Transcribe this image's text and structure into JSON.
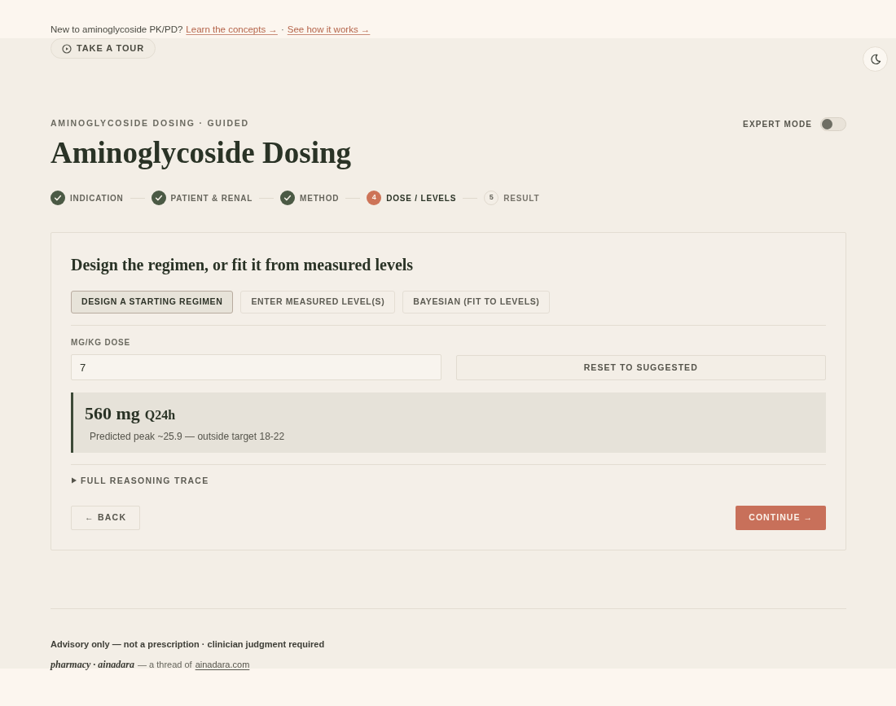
{
  "banner": {
    "intro": "New to aminoglycoside PK/PD?",
    "links": [
      "Learn the concepts →",
      "See how it works →"
    ],
    "separator": "·"
  },
  "tour_button": {
    "label": "TAKE A TOUR"
  },
  "header": {
    "eyebrow": "AMINOGLYCOSIDE DOSING · GUIDED",
    "title": "Aminoglycoside Dosing",
    "expert_mode": {
      "label": "EXPERT MODE",
      "on": false
    }
  },
  "steps": [
    {
      "label": "INDICATION",
      "completed": true,
      "selected": false
    },
    {
      "label": "PATIENT & RENAL",
      "completed": true,
      "selected": false
    },
    {
      "label": "METHOD",
      "completed": true,
      "selected": false
    },
    {
      "label": "DOSE / LEVELS",
      "number": "4",
      "completed": false,
      "selected": true
    },
    {
      "label": "RESULT",
      "number": "5",
      "completed": false,
      "selected": false
    }
  ],
  "card": {
    "heading": "Design the regimen, or fit it from measured levels",
    "modes": [
      {
        "label": "DESIGN A STARTING REGIMEN",
        "selected": true
      },
      {
        "label": "ENTER MEASURED LEVEL(S)",
        "selected": false
      },
      {
        "label": "BAYESIAN (FIT TO LEVELS)",
        "selected": false
      }
    ],
    "dose_field": {
      "label": "MG/KG DOSE",
      "value": "7"
    },
    "reset_button": "RESET TO SUGGESTED",
    "result": {
      "dose": "560 mg",
      "frequency": "Q24h",
      "note": "Predicted peak ~25.9 — outside target 18-22"
    },
    "trace": {
      "label": "FULL REASONING TRACE",
      "expanded": false
    },
    "back_button": "← BACK",
    "continue_button": "CONTINUE →"
  },
  "footer": {
    "disclaimer": "Advisory only — not a prescription · clinician judgment required",
    "brand": "pharmacy · ainadara",
    "credit": "— a thread of",
    "link": "ainadara.com"
  }
}
